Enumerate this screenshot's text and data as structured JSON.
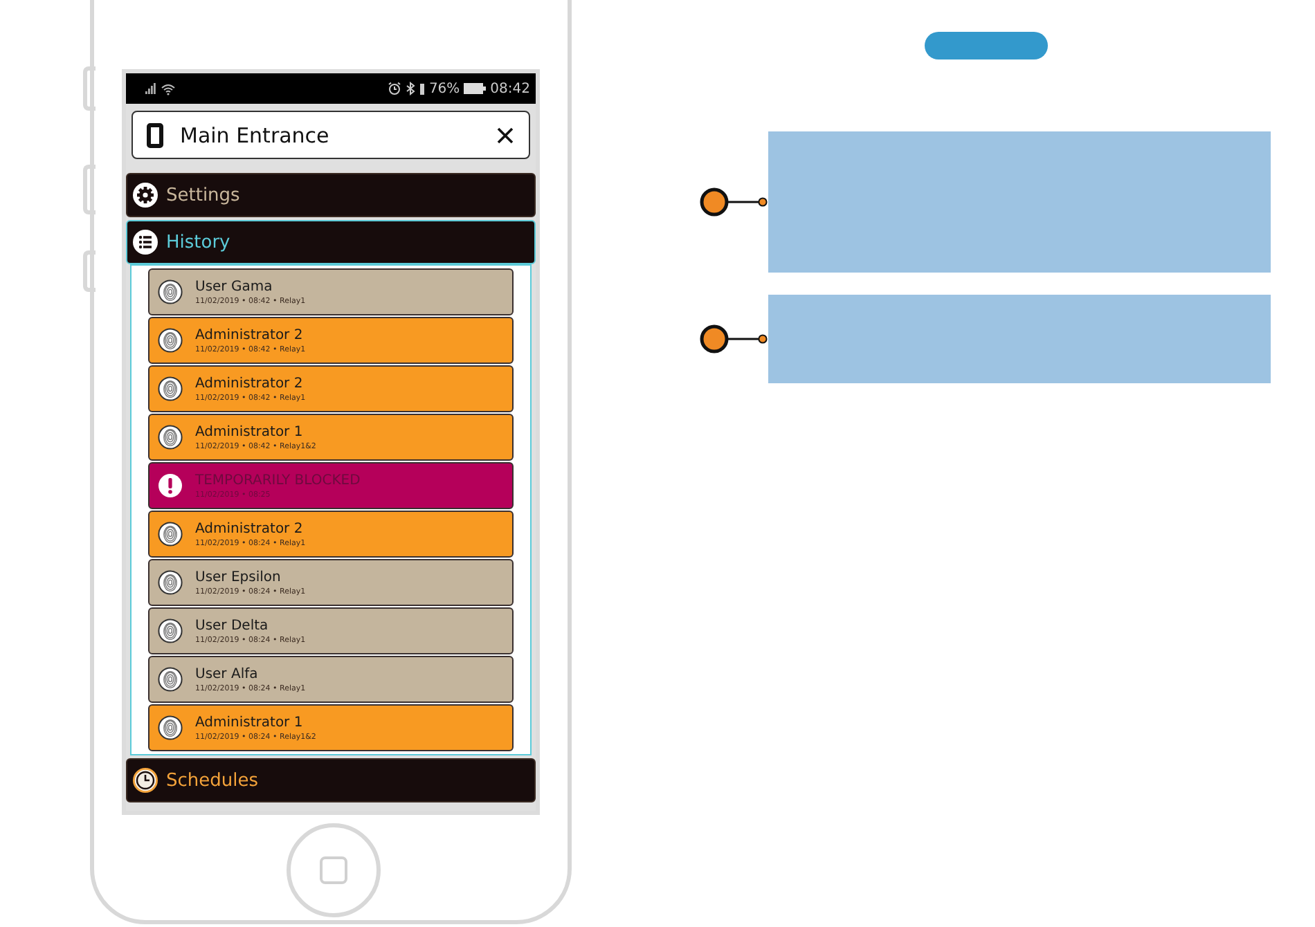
{
  "status_bar": {
    "battery": "76%",
    "time": "08:42"
  },
  "header": {
    "title": "Main Entrance"
  },
  "sections": [
    {
      "kind": "settings",
      "label": "Settings",
      "expanded": false,
      "color": "#c9b79c"
    },
    {
      "kind": "history",
      "label": "History",
      "expanded": true,
      "color": "#5ccbd9"
    },
    {
      "kind": "schedules",
      "label": "Schedules",
      "expanded": false,
      "color": "#f4a33a"
    }
  ],
  "events": [
    {
      "kind": "user",
      "name": "User Gama",
      "detail": "11/02/2019 • 08:42 • Relay1"
    },
    {
      "kind": "admin",
      "name": "Administrator 2",
      "detail": "11/02/2019 • 08:42 • Relay1"
    },
    {
      "kind": "admin",
      "name": "Administrator 2",
      "detail": "11/02/2019 • 08:42 • Relay1"
    },
    {
      "kind": "admin",
      "name": "Administrator 1",
      "detail": "11/02/2019 • 08:42 • Relay1&2"
    },
    {
      "kind": "blocked",
      "name": "TEMPORARILY BLOCKED",
      "detail": "11/02/2019 • 08:25"
    },
    {
      "kind": "admin",
      "name": "Administrator 2",
      "detail": "11/02/2019 • 08:24 • Relay1"
    },
    {
      "kind": "user",
      "name": "User Epsilon",
      "detail": "11/02/2019 • 08:24 • Relay1"
    },
    {
      "kind": "user",
      "name": "User Delta",
      "detail": "11/02/2019 • 08:24 • Relay1"
    },
    {
      "kind": "user",
      "name": "User Alfa",
      "detail": "11/02/2019 • 08:24 • Relay1"
    },
    {
      "kind": "admin",
      "name": "Administrator 1",
      "detail": "11/02/2019 • 08:24 • Relay1&2"
    }
  ],
  "callouts": [
    {
      "kind": "tall"
    },
    {
      "kind": "short"
    }
  ]
}
